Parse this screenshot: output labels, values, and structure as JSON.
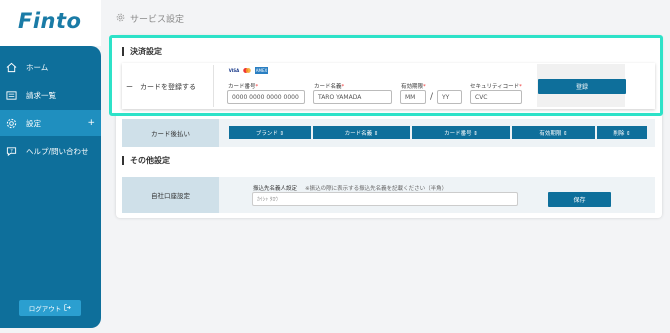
{
  "app": {
    "logo": "Finto"
  },
  "sidebar": {
    "items": [
      {
        "label": "ホーム",
        "icon": "home-icon"
      },
      {
        "label": "請求一覧",
        "icon": "list-icon"
      },
      {
        "label": "設定",
        "icon": "gear-icon",
        "active": true,
        "expand": "+"
      },
      {
        "label": "ヘルプ/問い合わせ",
        "icon": "help-chat-icon"
      }
    ],
    "logout": {
      "label": "ログアウト",
      "icon": "logout-icon"
    }
  },
  "header": {
    "title": "サービス設定",
    "icon": "gear-icon"
  },
  "payment": {
    "section_title": "決済設定",
    "add_card_label": "ー　カードを登録する",
    "card_brands": [
      "VISA",
      "MC",
      "AMEX"
    ],
    "fields": {
      "card_number": {
        "label": "カード番号",
        "required": "*",
        "placeholder": "0000 0000 0000 0000"
      },
      "card_name": {
        "label": "カード名義",
        "required": "*",
        "placeholder": "TARO YAMADA"
      },
      "expiry": {
        "label": "有効期限",
        "required": "*",
        "month_placeholder": "MM",
        "separator": "/",
        "year_placeholder": "YY"
      },
      "cvc": {
        "label": "セキュリティコード",
        "required": "*",
        "placeholder": "CVC"
      }
    },
    "register_button": "登録"
  },
  "card_payment": {
    "label": "カード後払い",
    "columns": [
      "ブランド ⇕",
      "カード名義 ⇕",
      "カード番号 ⇕",
      "有効期限 ⇕",
      "削除 ⇕"
    ]
  },
  "other": {
    "section_title": "その他設定",
    "bank_label": "自社口座設定",
    "transfer_label": "振込先名義人設定",
    "transfer_note": "※振込の際に表示する振込先名義を記載ください（半角）",
    "transfer_value": "ｶｲｼｬ ﾀﾛｳ",
    "save_button": "保存"
  },
  "colors": {
    "primary": "#0e6f9b",
    "highlight": "#2de2c8",
    "active": "#1f8fbf"
  }
}
